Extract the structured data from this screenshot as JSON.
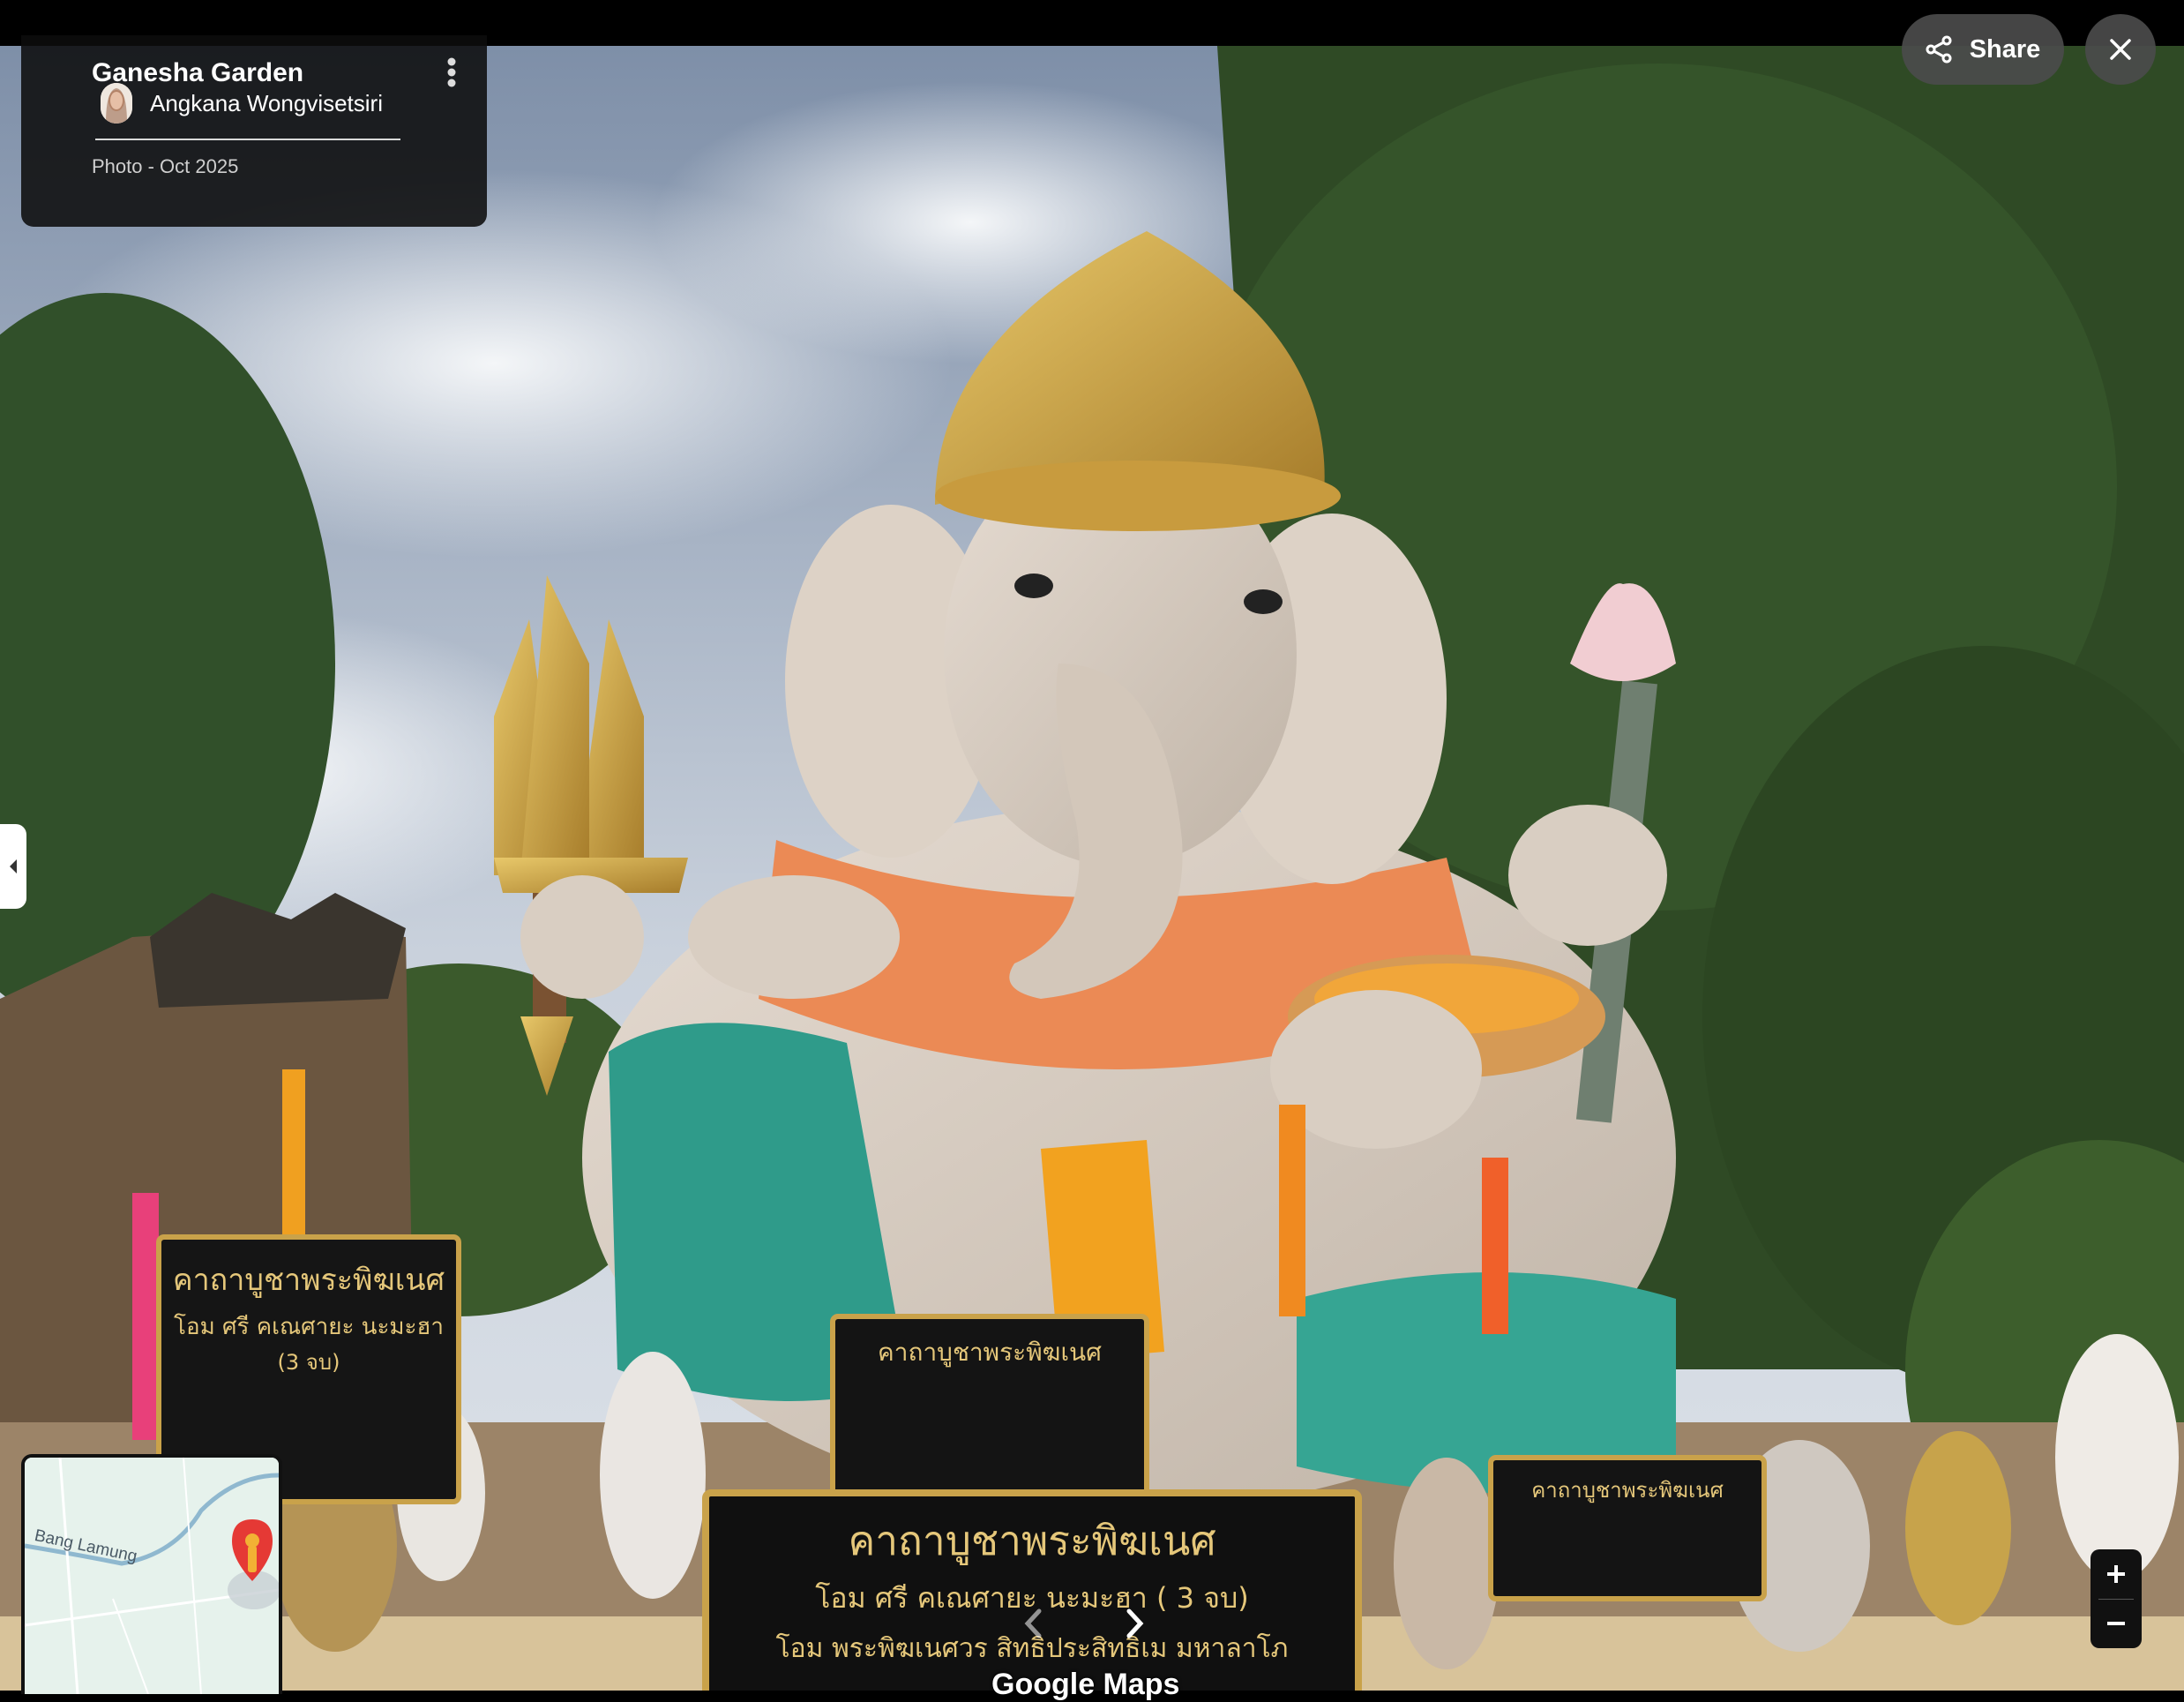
{
  "place": {
    "title": "Ganesha Garden",
    "author": "Angkana Wongvisetsiri",
    "meta": "Photo - Oct 2025"
  },
  "toolbar": {
    "share_label": "Share"
  },
  "map": {
    "label": "Bang Lamung"
  },
  "signs": {
    "main_title": "คาถาบูชาพระพิฆเนศ",
    "main_line1": "โอม ศรี คเณศายะ นะมะฮา ( 3 จบ)",
    "main_line2": "โอม พระพิฆเนศวร สิทธิประสิทธิเม มหาลาโภ",
    "left_title": "คาถาบูชาพระพิฆเนศ",
    "left_line1": "โอม ศรี คเณศายะ นะมะฮา",
    "left_line2": "(3 จบ)",
    "center_title": "คาถาบูชาพระพิฆเนศ",
    "right_title": "คาถาบูชาพระพิฆเนศ"
  },
  "watermark": "Google Maps",
  "icons": {
    "more": "more-vert-icon",
    "share": "share-icon",
    "close": "close-icon",
    "collapse": "chevron-left-icon",
    "zoom_in": "plus-icon",
    "zoom_out": "minus-icon",
    "pin": "map-pin-icon"
  },
  "colors": {
    "overlay": "#0c0c0c",
    "button_bg": "#4b4b4b",
    "pin": "#e53935"
  }
}
